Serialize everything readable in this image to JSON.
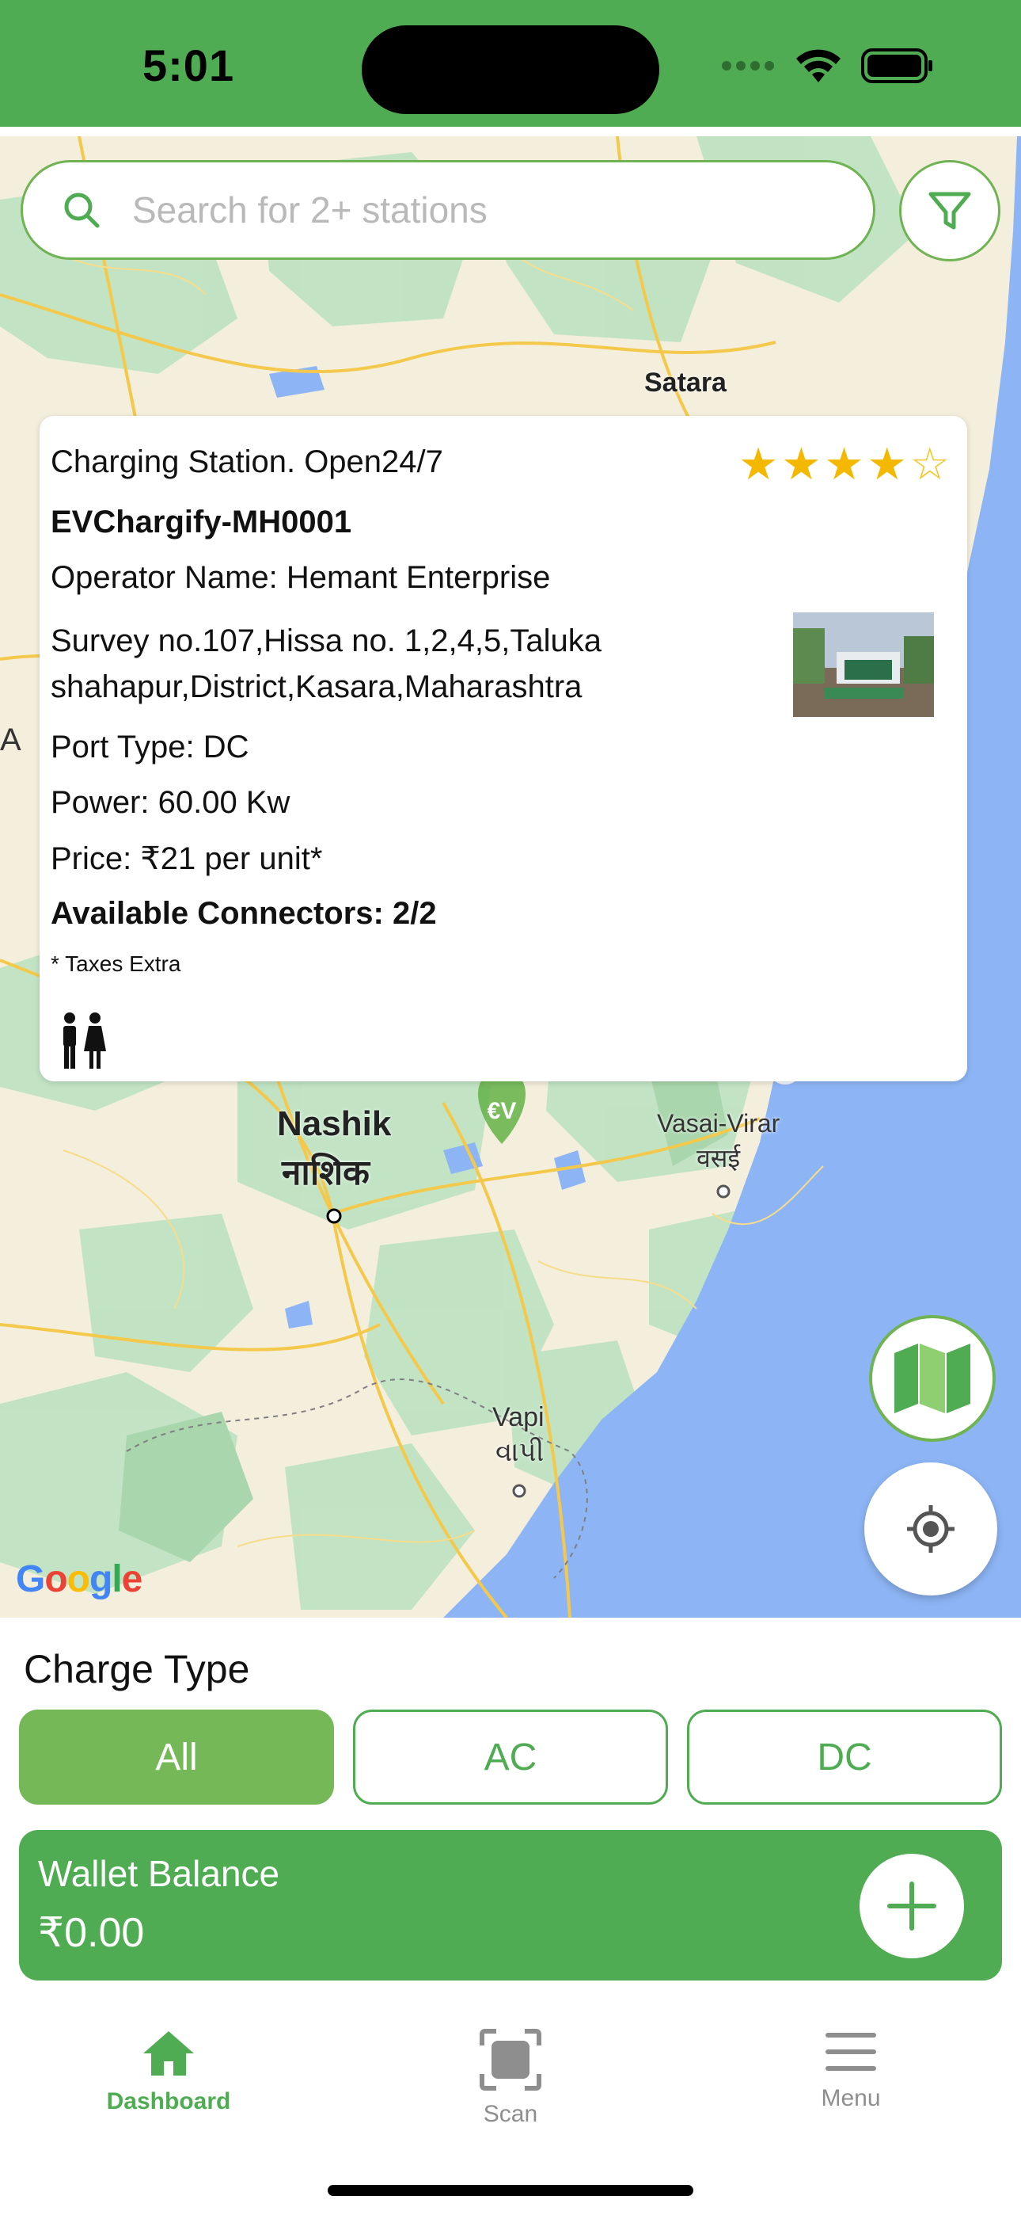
{
  "status_bar": {
    "time": "5:01"
  },
  "search": {
    "placeholder": "Search for 2+ stations"
  },
  "map": {
    "labels": {
      "satara": "Satara",
      "nashik": "Nashik",
      "nashik_local": "नाशिक",
      "vasai_virar": "Vasai-Virar",
      "vasai_local": "वसई",
      "vapi": "Vapi",
      "vapi_local": "વાપી",
      "edge_a": "A"
    },
    "marker_text": "€V",
    "google": "Google"
  },
  "station_card": {
    "status": "Charging Station. Open24/7",
    "rating_stars": 4,
    "rating_max": 5,
    "name": "EVChargify-MH0001",
    "operator": "Operator Name:  Hemant Enterprise",
    "address_line1": "Survey no.107,Hissa no. 1,2,4,5,Taluka",
    "address_line2": "shahapur,District,Kasara,Maharashtra",
    "port_type": "Port Type: DC",
    "power": "Power: 60.00 Kw",
    "price": "Price:  ₹21 per unit*",
    "connectors": "Available Connectors: 2/2",
    "taxes": "* Taxes Extra"
  },
  "charge_type": {
    "title": "Charge Type",
    "options": [
      "All",
      "AC",
      "DC"
    ],
    "selected": "All"
  },
  "wallet": {
    "label": "Wallet Balance",
    "amount": "₹0.00"
  },
  "tabs": [
    {
      "label": "Dashboard",
      "icon": "home-icon",
      "active": true
    },
    {
      "label": "Scan",
      "icon": "scan-icon",
      "active": false
    },
    {
      "label": "Menu",
      "icon": "menu-icon",
      "active": false
    }
  ],
  "colors": {
    "brand_green": "#4fac52",
    "light_green": "#74b857",
    "star": "#f5b800",
    "water": "#8db5f5"
  }
}
